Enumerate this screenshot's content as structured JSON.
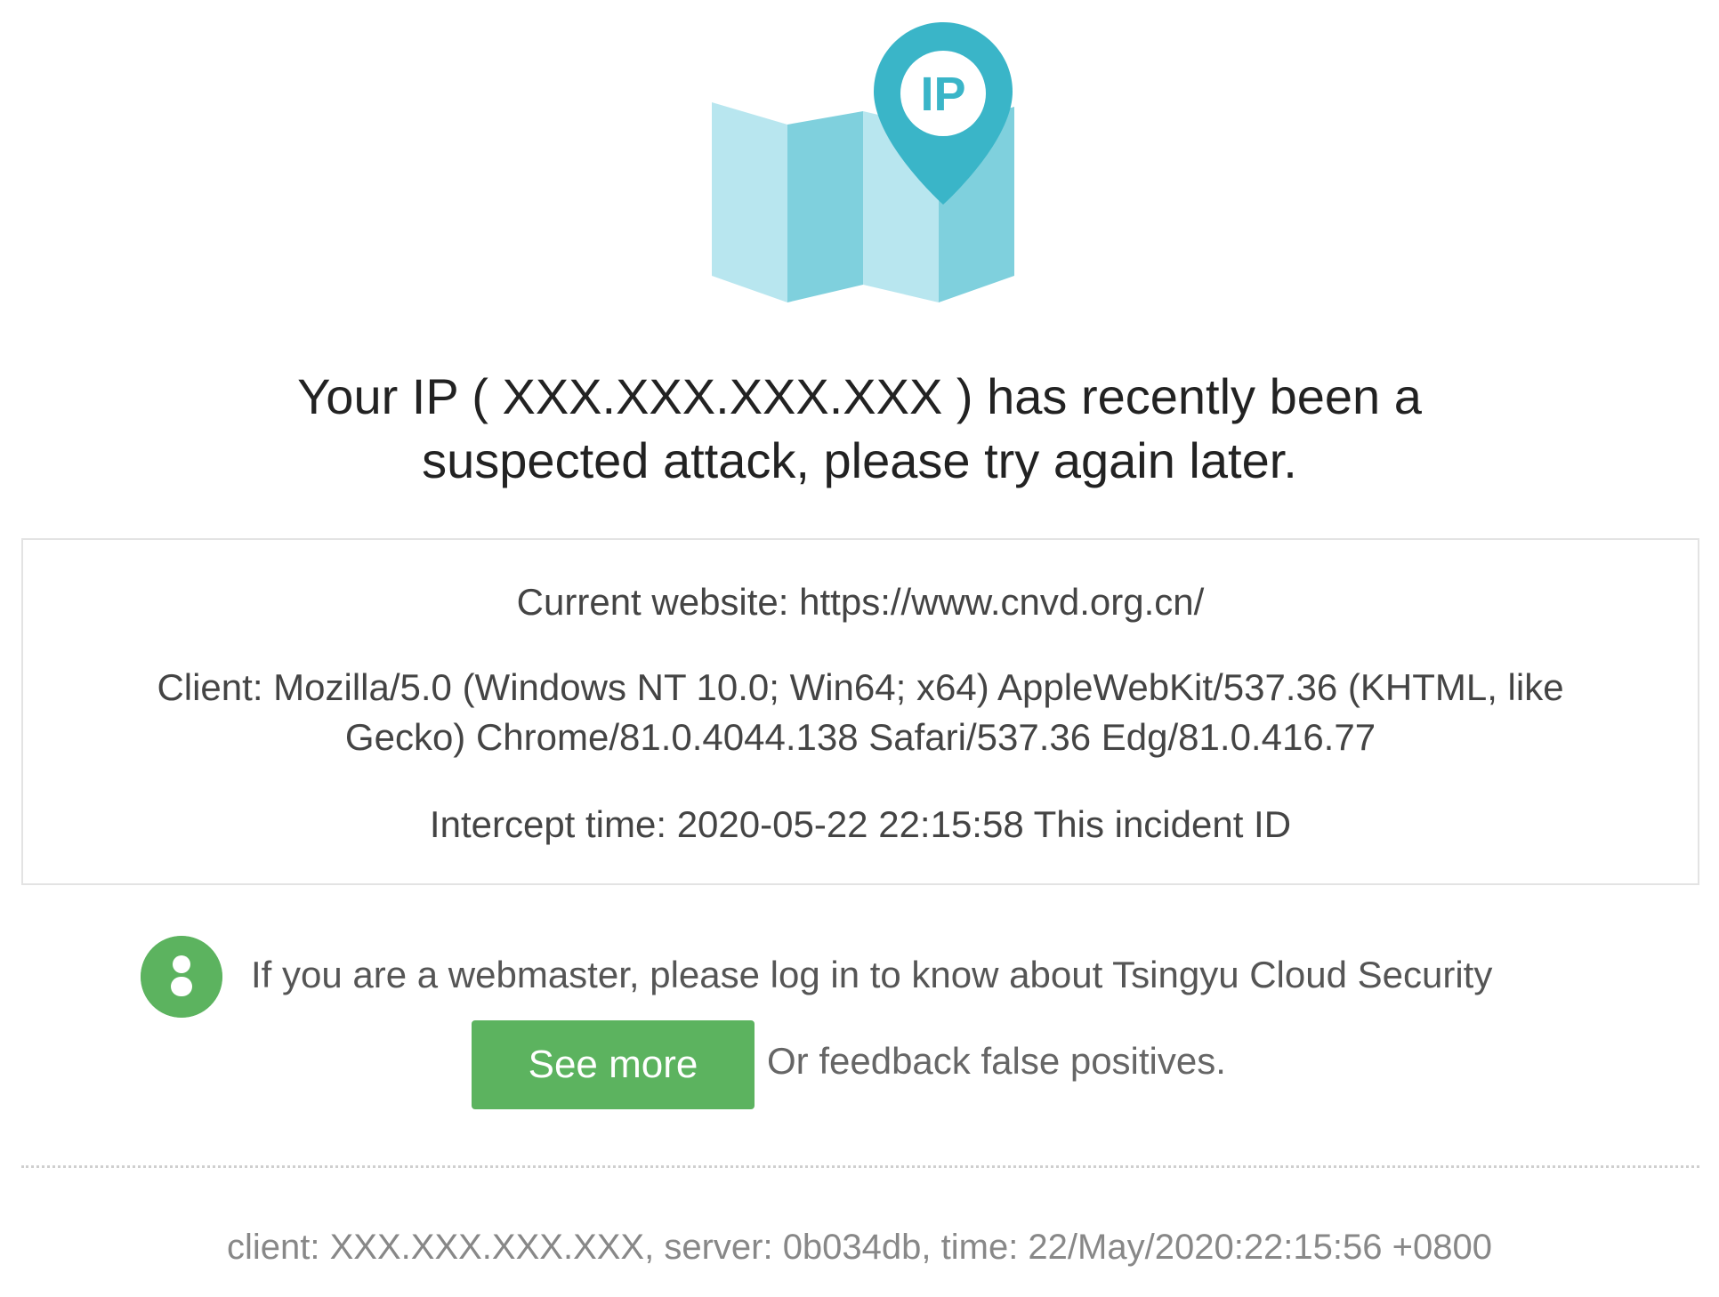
{
  "hero": {
    "icon": "map-ip-location-icon",
    "badge_text": "IP",
    "colors": {
      "pin": "#3ab5c8",
      "map_light": "#b8e6ef",
      "map_mid": "#7fd0dd"
    }
  },
  "headline": {
    "line1": "Your IP ( XXX.XXX.XXX.XXX ) has recently been a",
    "line2": "suspected attack, please try again later."
  },
  "info": {
    "current_website": "Current website: https://www.cnvd.org.cn/",
    "client": "Client:  Mozilla/5.0 (Windows NT 10.0; Win64; x64) AppleWebKit/537.36 (KHTML, like Gecko) Chrome/81.0.4044.138 Safari/537.36 Edg/81.0.416.77",
    "intercept_time": "Intercept time: 2020-05-22 22:15:58 This incident ID"
  },
  "webmaster": {
    "icon": "user-icon",
    "text": "If you are a webmaster, please log in to know about Tsingyu Cloud Security",
    "button_label": "See more",
    "feedback_text": "Or feedback false positives."
  },
  "footer": {
    "text": "client: XXX.XXX.XXX.XXX, server: 0b034db, time: 22/May/2020:22:15:56 +0800"
  },
  "colors": {
    "accent_green": "#5cb35f",
    "border": "#e3e3e3"
  }
}
